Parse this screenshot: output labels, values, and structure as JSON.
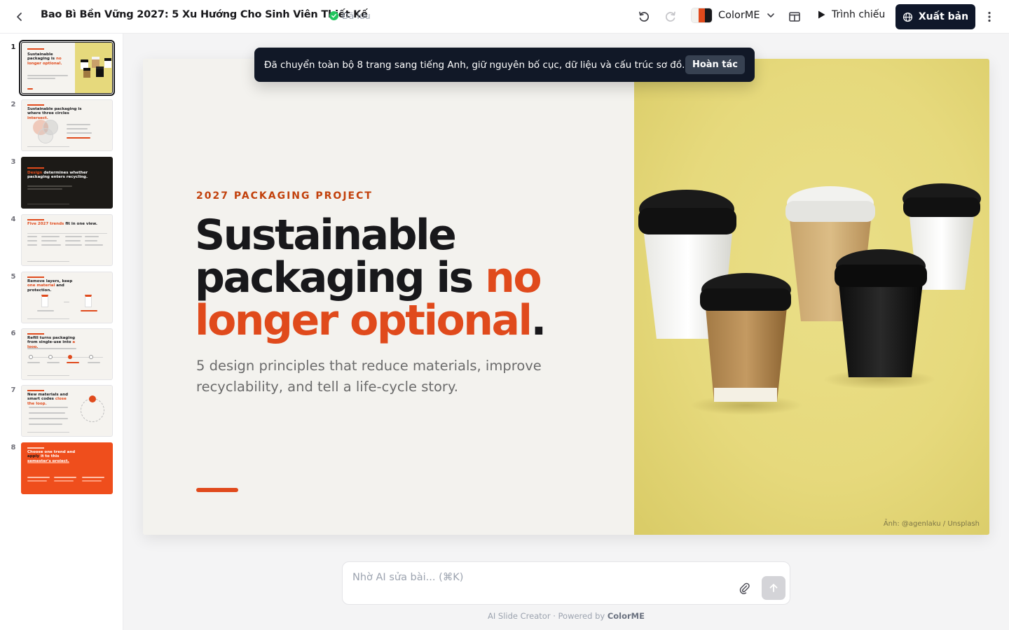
{
  "header": {
    "title": "Bao Bì Bền Vững 2027: 5 Xu Hướng Cho Sinh Viên Thiết Kế",
    "save_status": "Đã lưu",
    "brand_name": "ColorME",
    "present_label": "Trình chiếu",
    "publish_label": "Xuất bản"
  },
  "toast": {
    "message": "Đã chuyển toàn bộ 8 trang sang tiếng Anh, giữ nguyên bố cục, dữ liệu và cấu trúc sơ đồ.",
    "undo_label": "Hoàn tác"
  },
  "thumbnails": [
    {
      "number": "1",
      "title_a": "Sustainable packaging is ",
      "title_b": "no longer optional.",
      "theme": "photo"
    },
    {
      "number": "2",
      "title_a": "Sustainable packaging is where three circles ",
      "title_b": "intersect.",
      "theme": "light"
    },
    {
      "number": "3",
      "title_a": "",
      "title_b": "Design",
      "title_c": " determines whether packaging enters recycling.",
      "theme": "dark"
    },
    {
      "number": "4",
      "title_a": "",
      "title_b": "Five 2027 trends",
      "title_c": " fit in one view.",
      "theme": "light"
    },
    {
      "number": "5",
      "title_a": "Remove layers, keep ",
      "title_b": "one material",
      "title_c": " and protection.",
      "theme": "light"
    },
    {
      "number": "6",
      "title_a": "Refill turns packaging from single-use into ",
      "title_b": "a loop.",
      "theme": "light"
    },
    {
      "number": "7",
      "title_a": "New materials and smart codes ",
      "title_b": "close the loop.",
      "theme": "light"
    },
    {
      "number": "8",
      "title_a": "Choose one trend and ",
      "title_b": "apply",
      "title_c": " it to this semester's project.",
      "theme": "orange"
    }
  ],
  "slide": {
    "kicker": "2027 PACKAGING PROJECT",
    "headline_a": "Sustainable packaging is ",
    "headline_accent": "no longer optional",
    "headline_end": ".",
    "subtitle": "5 design principles that reduce materials, improve recyclability, and tell a life-cycle story.",
    "photo_credit": "Ảnh: @agenlaku / Unsplash"
  },
  "prompt": {
    "placeholder": "Nhờ AI sửa bài... (⌘K)"
  },
  "footer": {
    "prefix": "AI Slide Creator · Powered by ",
    "brand": "ColorME"
  },
  "colors": {
    "accent": "#e04a1c",
    "dark": "#0f172a",
    "photo_bg": "#e6d97c"
  },
  "icons": [
    "chevron-left-icon",
    "check-circle-icon",
    "undo-icon",
    "redo-icon",
    "chevron-down-icon",
    "layout-icon",
    "play-icon",
    "globe-icon",
    "more-vertical-icon",
    "paperclip-icon",
    "arrow-up-icon"
  ]
}
